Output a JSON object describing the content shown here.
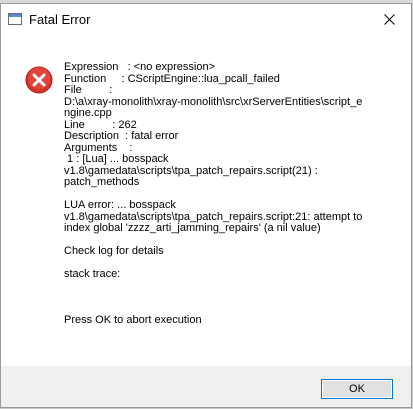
{
  "window": {
    "title": "Fatal Error",
    "app_icon": "window-icon",
    "close_icon": "close-icon"
  },
  "message": {
    "icon": "error-icon",
    "lines": [
      "Expression   : <no expression>",
      "Function     : CScriptEngine::lua_pcall_failed",
      "File         :",
      "D:\\a\\xray-monolith\\xray-monolith\\src\\xrServerEntities\\script_e",
      "ngine.cpp",
      "Line         : 262",
      "Description  : fatal error",
      "Arguments    :",
      " 1 : [Lua] ... bosspack",
      "v1.8\\gamedata\\scripts\\tpa_patch_repairs.script(21) :",
      "patch_methods",
      "",
      "LUA error: ... bosspack",
      "v1.8\\gamedata\\scripts\\tpa_patch_repairs.script:21: attempt to",
      "index global 'zzzz_arti_jamming_repairs' (a nil value)",
      "",
      "Check log for details",
      "",
      "stack trace:",
      "",
      "",
      "",
      "Press OK to abort execution"
    ]
  },
  "buttons": {
    "ok_label": "OK"
  },
  "colors": {
    "error_red": "#d9342b",
    "focus_border": "#0078d7",
    "footer_bg": "#f0f0f0"
  }
}
